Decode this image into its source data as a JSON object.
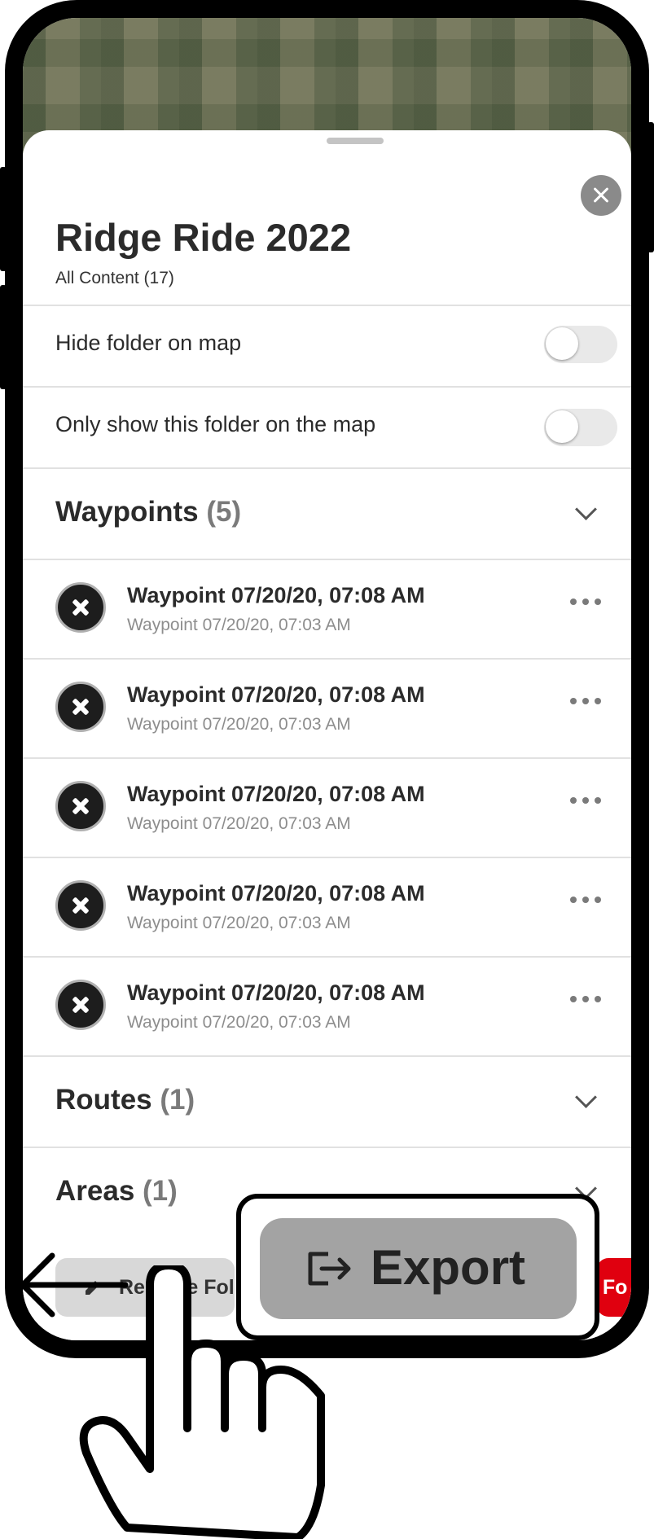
{
  "folder": {
    "title": "Ridge Ride 2022",
    "subtitle": "All Content (17)"
  },
  "settings": {
    "hide_folder": "Hide folder on map",
    "only_show": "Only show this folder on the map"
  },
  "sections": {
    "waypoints": {
      "label": "Waypoints",
      "count": "(5)"
    },
    "routes": {
      "label": "Routes",
      "count": "(1)"
    },
    "areas": {
      "label": "Areas",
      "count": "(1)"
    }
  },
  "waypoints": [
    {
      "title": "Waypoint 07/20/20, 07:08 AM",
      "subtitle": "Waypoint 07/20/20, 07:03 AM"
    },
    {
      "title": "Waypoint 07/20/20, 07:08 AM",
      "subtitle": "Waypoint 07/20/20, 07:03 AM"
    },
    {
      "title": "Waypoint 07/20/20, 07:08 AM",
      "subtitle": "Waypoint 07/20/20, 07:03 AM"
    },
    {
      "title": "Waypoint 07/20/20, 07:08 AM",
      "subtitle": "Waypoint 07/20/20, 07:03 AM"
    },
    {
      "title": "Waypoint 07/20/20, 07:08 AM",
      "subtitle": "Waypoint 07/20/20, 07:03 AM"
    }
  ],
  "actions": {
    "rename_label": "Rename Fol",
    "export_label": "Export",
    "delete_label": "e Fo"
  },
  "icons": {
    "close": "close-icon",
    "waypoint": "x-circle-icon",
    "more": "more-horizontal-icon",
    "chevron": "chevron-down-icon",
    "pencil": "pencil-icon",
    "export": "export-icon",
    "gesture": "tap-hand-icon"
  },
  "colors": {
    "delete": "#e0000f",
    "export_button": "#a3a3a3"
  }
}
